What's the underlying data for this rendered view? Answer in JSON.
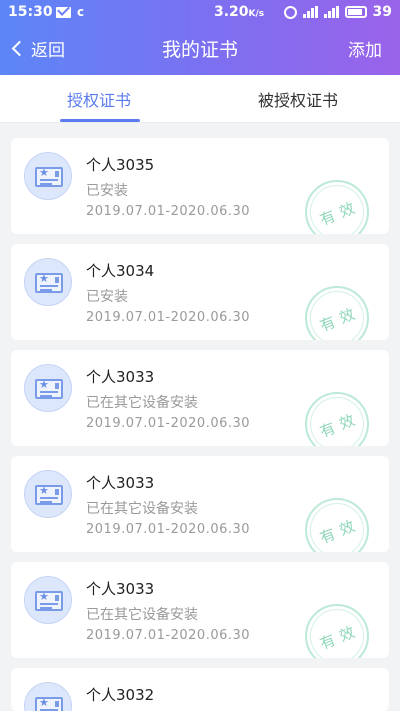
{
  "status_bar": {
    "time": "15:30",
    "speed": "3.20",
    "speed_unit": "K/s",
    "battery": "39",
    "app_badge": "c"
  },
  "nav": {
    "back_label": "返回",
    "title": "我的证书",
    "add_label": "添加"
  },
  "tabs": [
    {
      "label": "授权证书",
      "active": true
    },
    {
      "label": "被授权证书",
      "active": false
    }
  ],
  "certificates": [
    {
      "name": "个人3035",
      "status": "已安装",
      "validity": "2019.07.01-2020.06.30",
      "stamp": "有效"
    },
    {
      "name": "个人3034",
      "status": "已安装",
      "validity": "2019.07.01-2020.06.30",
      "stamp": "有效"
    },
    {
      "name": "个人3033",
      "status": "已在其它设备安装",
      "validity": "2019.07.01-2020.06.30",
      "stamp": "有效"
    },
    {
      "name": "个人3033",
      "status": "已在其它设备安装",
      "validity": "2019.07.01-2020.06.30",
      "stamp": "有效"
    },
    {
      "name": "个人3033",
      "status": "已在其它设备安装",
      "validity": "2019.07.01-2020.06.30",
      "stamp": "有效"
    },
    {
      "name": "个人3032",
      "status": "",
      "validity": "",
      "stamp": ""
    }
  ]
}
